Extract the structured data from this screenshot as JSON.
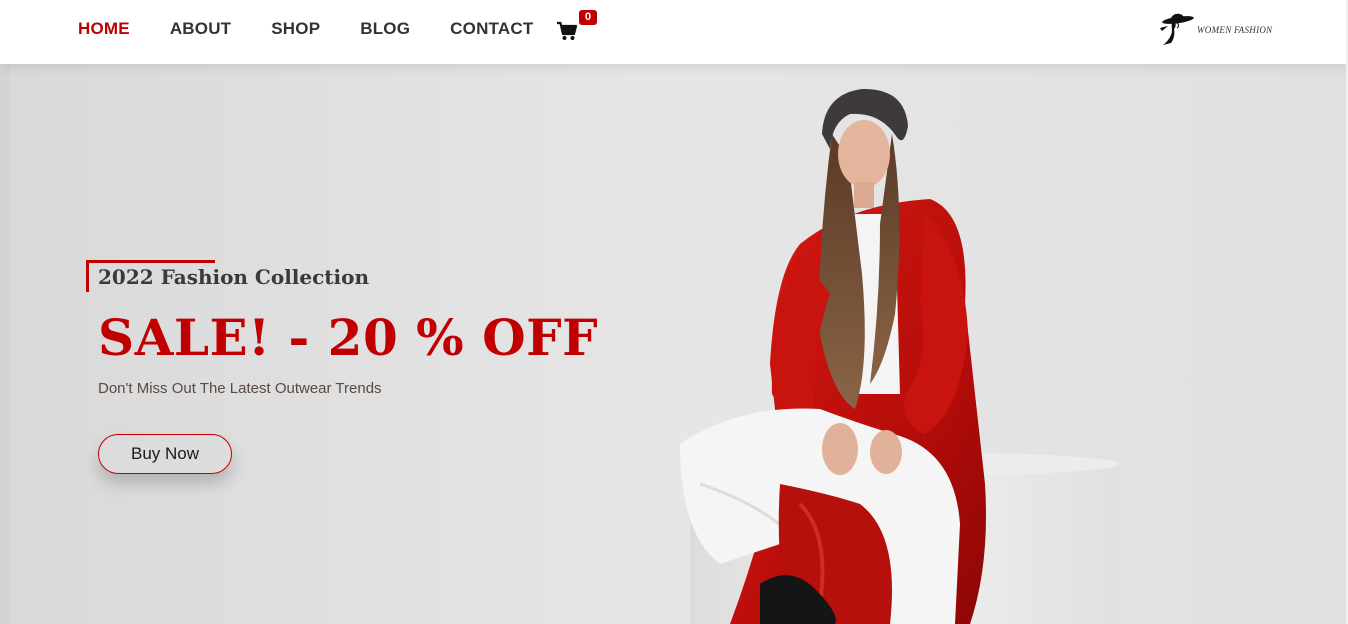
{
  "nav": {
    "items": [
      {
        "label": "HOME",
        "active": true
      },
      {
        "label": "ABOUT",
        "active": false
      },
      {
        "label": "SHOP",
        "active": false
      },
      {
        "label": "BLOG",
        "active": false
      },
      {
        "label": "CONTACT",
        "active": false
      }
    ],
    "cart_icon": "shopping-cart-icon",
    "cart_count": "0"
  },
  "logo": {
    "text": "WOMEN FASHION",
    "icon": "woman-hat-silhouette-icon"
  },
  "hero": {
    "kicker": "2022 Fashion Collection",
    "headline": "SALE! - 20 % OFF",
    "subline": "Don't Miss Out The Latest Outwear Trends",
    "cta_label": "Buy Now"
  },
  "colors": {
    "accent": "#c00000",
    "nav_text": "#333333",
    "hero_bg": "#e2e2e3"
  }
}
